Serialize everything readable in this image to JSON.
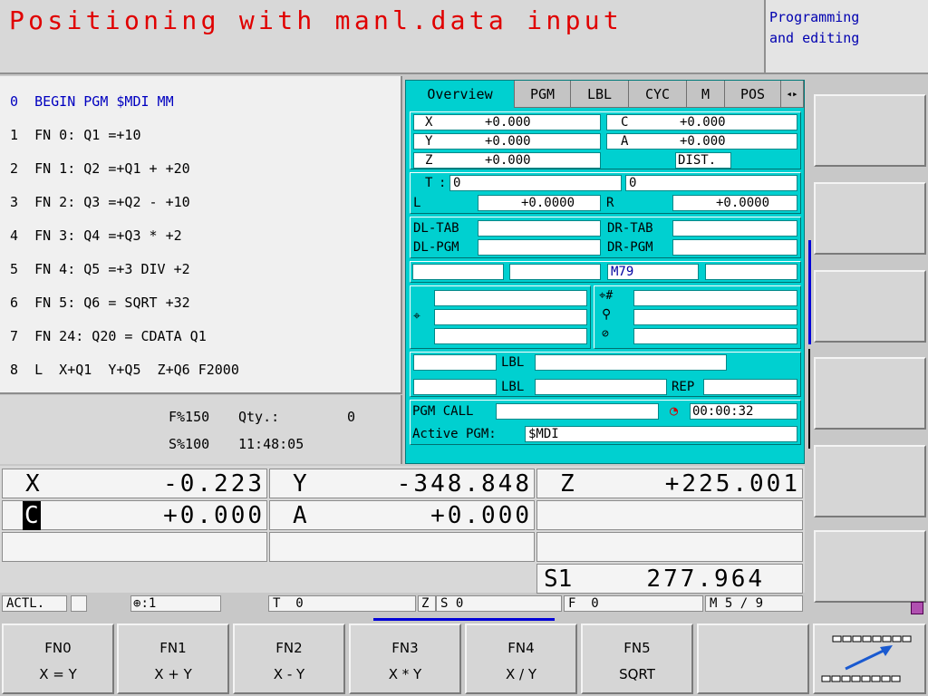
{
  "header": {
    "title": "Positioning with manl.data input",
    "mode_line1": "Programming",
    "mode_line2": "and editing"
  },
  "program": {
    "lines": [
      "0  BEGIN PGM $MDI MM",
      "1  FN 0: Q1 =+10",
      "2  FN 1: Q2 =+Q1 + +20",
      "3  FN 2: Q3 =+Q2 - +10",
      "4  FN 3: Q4 =+Q3 * +2",
      "5  FN 4: Q5 =+3 DIV +2",
      "6  FN 5: Q6 = SQRT +32",
      "7  FN 24: Q20 = CDATA Q1",
      "8  L  X+Q1  Y+Q5  Z+Q6 F2000"
    ]
  },
  "status": {
    "feed_override": "F%150",
    "qty_label": "Qty.:",
    "qty_value": "0",
    "spindle_override": "S%100",
    "time": "11:48:05"
  },
  "status_window": {
    "tabs": [
      "Overview",
      "PGM",
      "LBL",
      "CYC",
      "M",
      "POS"
    ],
    "x_label": "X",
    "x_value": "+0.000",
    "y_label": "Y",
    "y_value": "+0.000",
    "z_label": "Z",
    "z_value": "+0.000",
    "c_label": "C",
    "c_value": "+0.000",
    "a_label": "A",
    "a_value": "+0.000",
    "dist_label": "DIST.",
    "t_label": "T",
    "t_value": "0",
    "t_value2": "0",
    "l_label": "L",
    "l_value": "+0.0000",
    "r_label": "R",
    "r_value": "+0.0000",
    "dl_tab": "DL-TAB",
    "dr_tab": "DR-TAB",
    "dl_pgm": "DL-PGM",
    "dr_pgm": "DR-PGM",
    "m_value": "M79",
    "lbl1": "LBL",
    "lbl2": "LBL",
    "rep": "REP",
    "pgm_call": "PGM CALL",
    "timer": "00:00:32",
    "active_pgm_label": "Active PGM:",
    "active_pgm_value": "$MDI"
  },
  "positions": {
    "x_axis": "X",
    "x_value": "-0.223",
    "y_axis": "Y",
    "y_value": "-348.848",
    "z_axis": "Z",
    "z_value": "+225.001",
    "c_axis": "C",
    "c_value": "+0.000",
    "a_axis": "A",
    "a_value": "+0.000",
    "s_label": "S1",
    "s_value": "277.964"
  },
  "bottom_line": {
    "mode": "ACTL.",
    "datum": ":1",
    "tool": "T  0",
    "zs": "Z",
    "s": "S 0",
    "f": "F  0",
    "m": "M 5 / 9"
  },
  "softkeys": [
    {
      "line1": "FN0",
      "line2": "X = Y"
    },
    {
      "line1": "FN1",
      "line2": "X + Y"
    },
    {
      "line1": "FN2",
      "line2": "X - Y"
    },
    {
      "line1": "FN3",
      "line2": "X * Y"
    },
    {
      "line1": "FN4",
      "line2": "X / Y"
    },
    {
      "line1": "FN5",
      "line2": "SQRT"
    },
    {
      "line1": "",
      "line2": ""
    }
  ],
  "colors": {
    "title_red": "#e00000",
    "status_cyan": "#00d0d0",
    "blue_text": "#0000c0"
  }
}
